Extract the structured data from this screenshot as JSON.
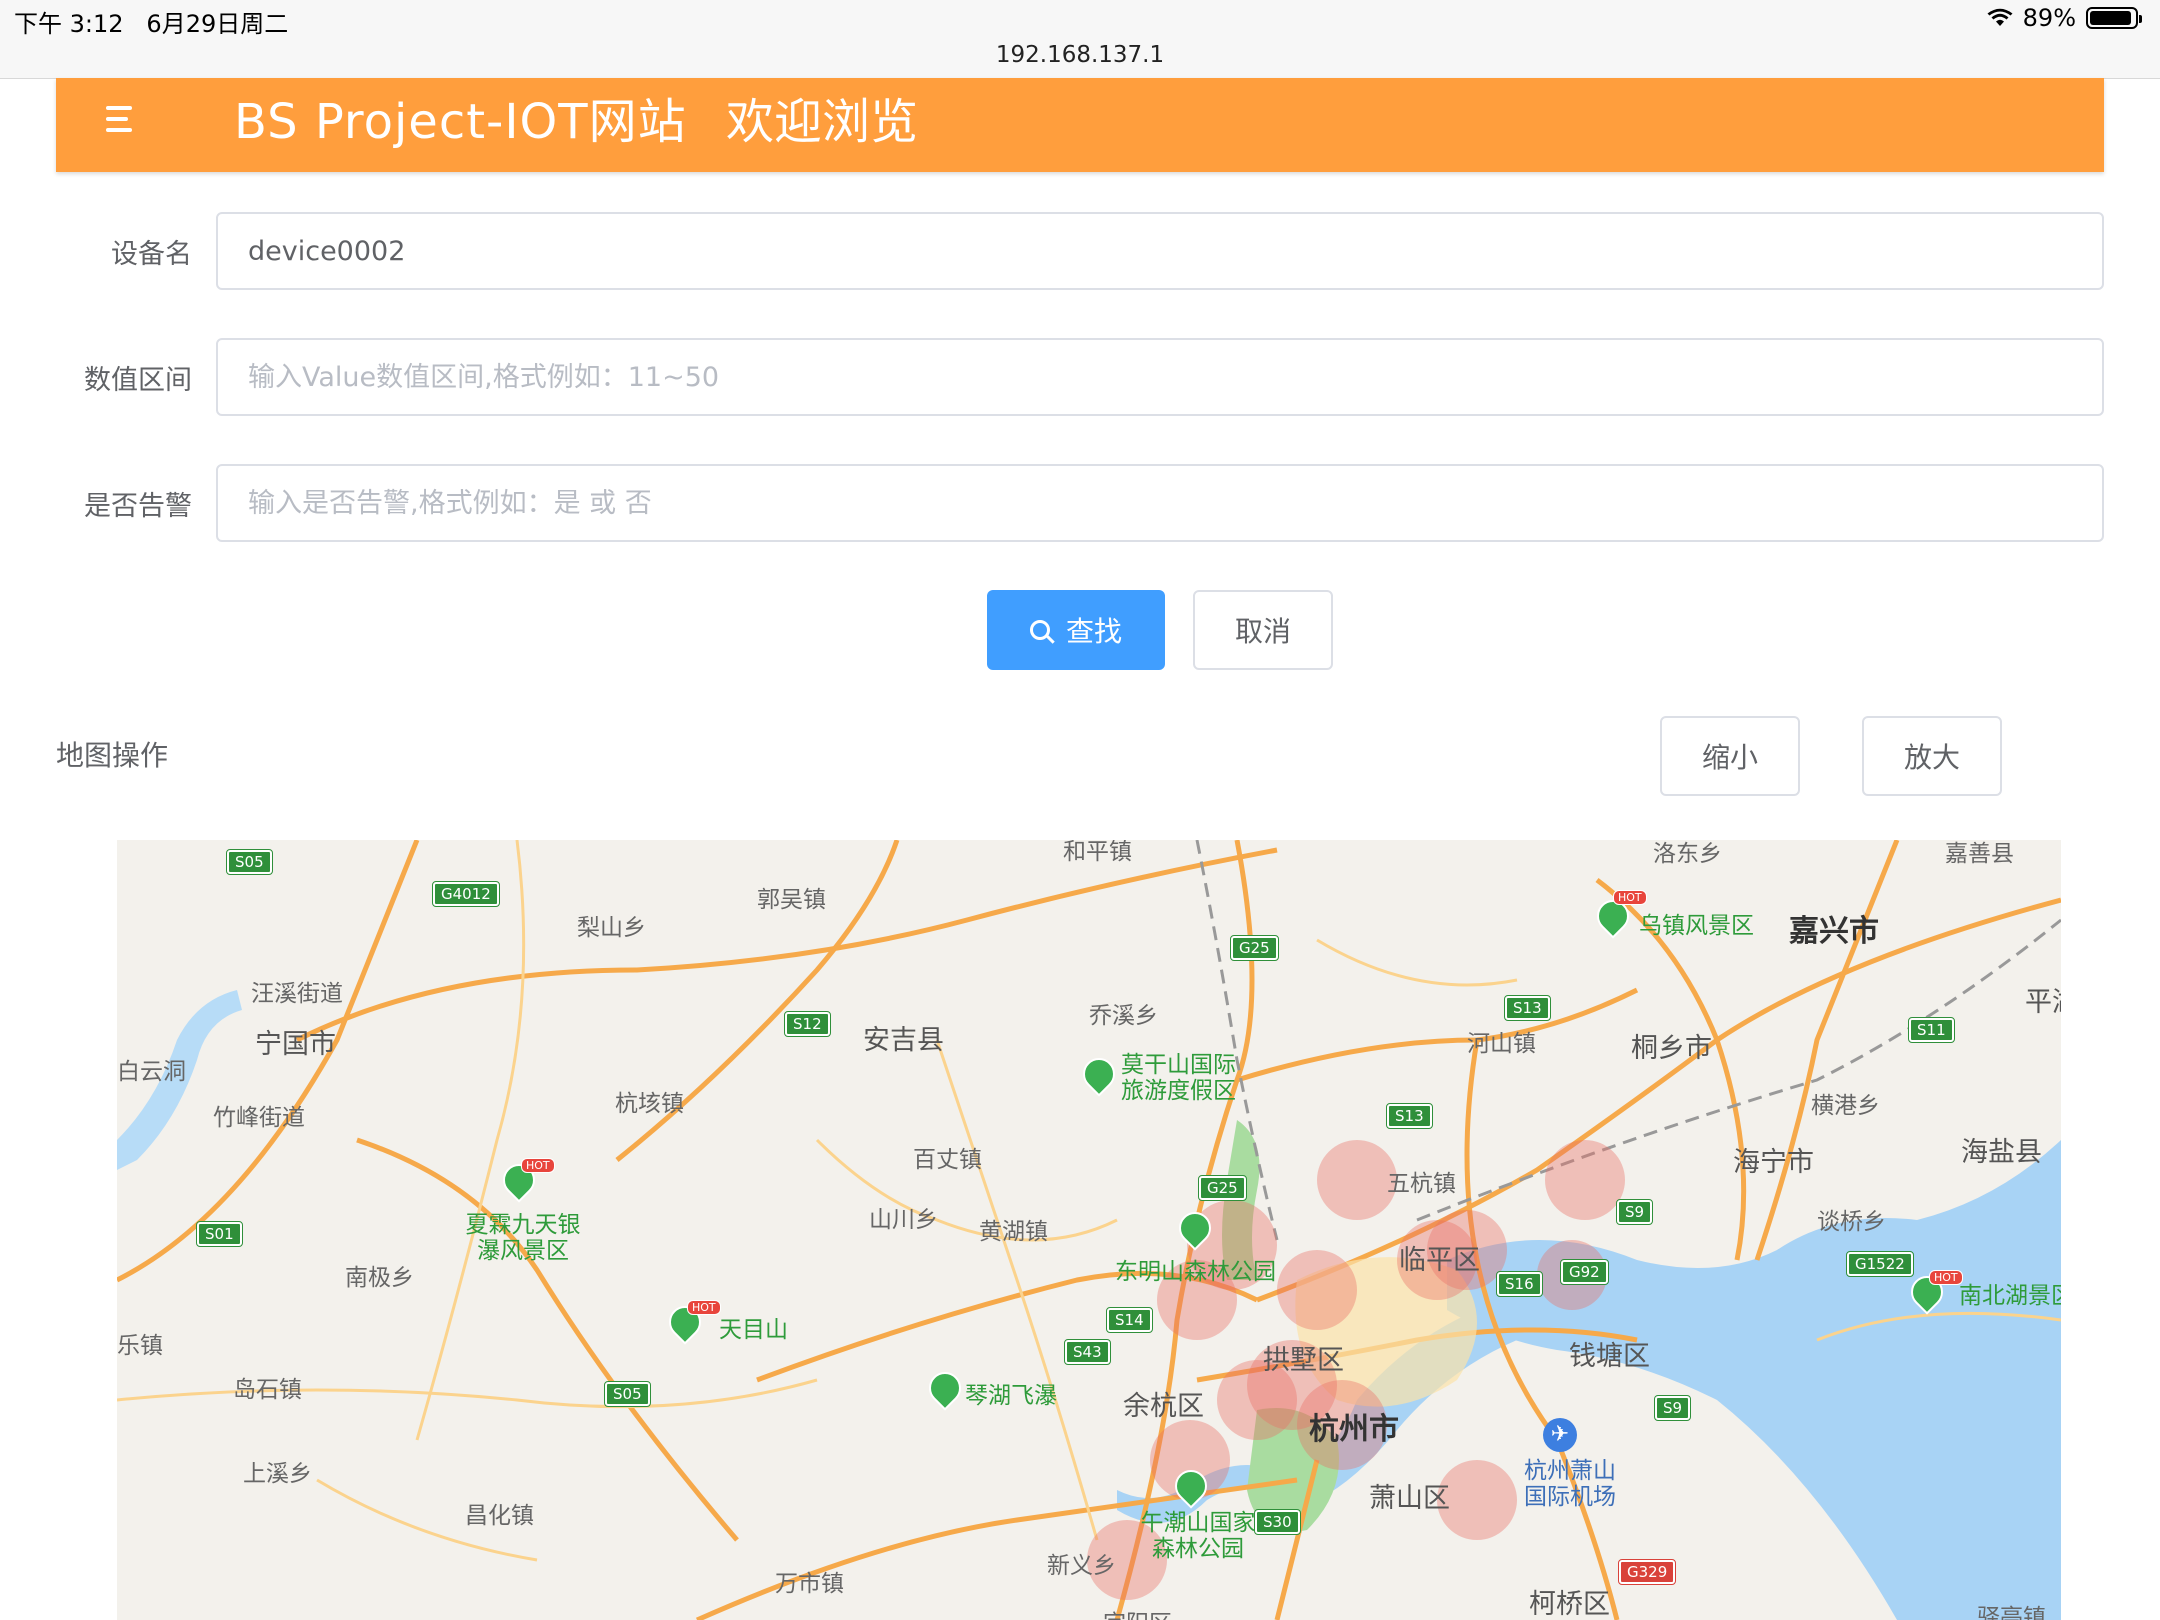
{
  "status_bar": {
    "time": "下午 3:12",
    "date": "6月29日周二",
    "battery": "89%"
  },
  "url": "192.168.137.1",
  "header": {
    "title": "BS Project-IOT网站",
    "welcome": "欢迎浏览"
  },
  "form": {
    "device_label": "设备名",
    "device_value": "device0002",
    "range_label": "数值区间",
    "range_placeholder": "输入Value数值区间,格式例如：11~50",
    "alarm_label": "是否告警",
    "alarm_placeholder": "输入是否告警,格式例如：是 或 否",
    "search_button": "查找",
    "cancel_button": "取消"
  },
  "map_controls": {
    "label": "地图操作",
    "zoom_out": "缩小",
    "zoom_in": "放大"
  },
  "map": {
    "cities": [
      "嘉兴市",
      "杭州市",
      "宁国市",
      "安吉县",
      "桐乡市",
      "海宁市",
      "海盐县",
      "临平区",
      "拱墅区",
      "余杭区",
      "萧山区",
      "钱塘区",
      "柯桥区"
    ],
    "places": [
      "郭吴镇",
      "梨山乡",
      "汪溪街道",
      "白云洞",
      "竹峰街道",
      "杭垓镇",
      "乔溪乡",
      "百丈镇",
      "山川乡",
      "黄湖镇",
      "南极乡",
      "乐镇",
      "岛石镇",
      "上溪乡",
      "昌化镇",
      "万市镇",
      "新义乡",
      "河山镇",
      "横港乡",
      "五杭镇",
      "谈桥乡",
      "洛东乡",
      "嘉善县",
      "平湖",
      "宗阳区",
      "驿亭镇",
      "和平镇"
    ],
    "pois": [
      "乌镇风景区",
      "莫干山国际旅游度假区",
      "夏霖九天银瀑风景区",
      "天目山",
      "琴湖飞瀑",
      "东明山森林公园",
      "午潮山国家森林公园",
      "南北湖景区",
      "杭州萧山国际机场"
    ],
    "roads": [
      "S05",
      "G4012",
      "G25",
      "S12",
      "S13",
      "S11",
      "S01",
      "S14",
      "S43",
      "S16",
      "G92",
      "S9",
      "G1522",
      "S30",
      "G329"
    ],
    "hot_tag": "HOT",
    "airport_icon": "airplane-icon"
  },
  "colors": {
    "header": "#ff9e3d",
    "primary": "#409eff",
    "heat": "#eb6e64"
  }
}
